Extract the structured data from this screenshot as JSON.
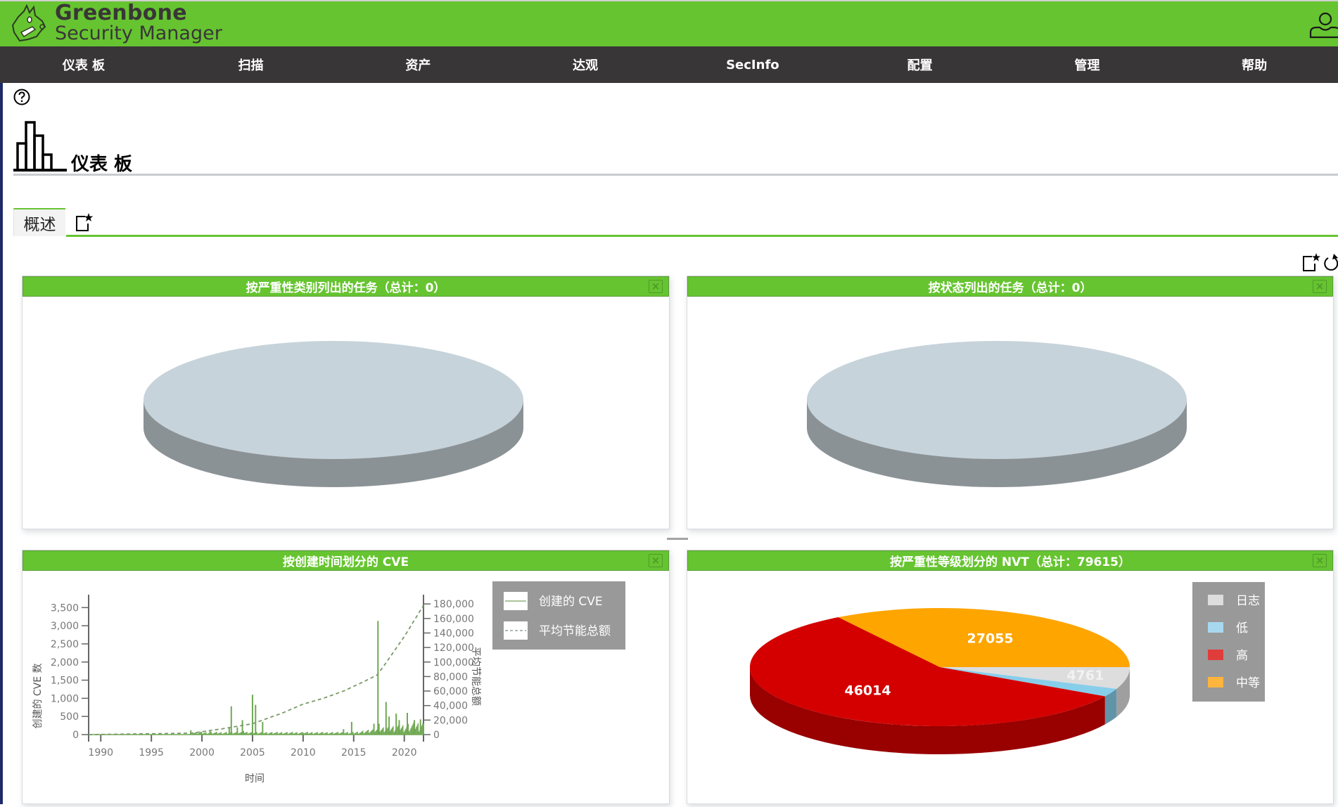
{
  "app": {
    "brand_name": "Greenbone",
    "brand_sub": "Security Manager"
  },
  "nav": {
    "items": [
      {
        "label": "仪表 板"
      },
      {
        "label": "扫描"
      },
      {
        "label": "资产"
      },
      {
        "label": "达观"
      },
      {
        "label": "SecInfo"
      },
      {
        "label": "配置"
      },
      {
        "label": "管理"
      },
      {
        "label": "帮助"
      }
    ]
  },
  "page": {
    "title": "仪表 板",
    "tabs": [
      {
        "label": "概述"
      }
    ]
  },
  "colors": {
    "brand_green": "#66c430",
    "nav_dark": "#393637",
    "severity_high": "#d40000",
    "severity_medium": "#fea500",
    "severity_low": "#87ceeb",
    "severity_log": "#dddddd"
  },
  "panels": [
    {
      "title": "按严重性类别列出的任务（总计：0）",
      "close_label": "×"
    },
    {
      "title": "按状态列出的任务（总计：0）",
      "close_label": "×"
    },
    {
      "title": "按创建时间划分的 CVE",
      "close_label": "×"
    },
    {
      "title": "按严重性等级划分的 NVT（总计：79615）",
      "close_label": "×"
    }
  ],
  "chart_data": [
    {
      "type": "pie",
      "title": "按严重性类别列出的任务（总计：0）",
      "labels": [],
      "values": [],
      "empty": true,
      "style": "3d"
    },
    {
      "type": "pie",
      "title": "按状态列出的任务（总计：0）",
      "labels": [],
      "values": [],
      "empty": true,
      "style": "3d"
    },
    {
      "type": "line",
      "title": "按创建时间划分的 CVE",
      "xlabel": "时间",
      "ylabel": "创建的 CVE 数",
      "y2label": "平均节能总额",
      "xlim": [
        1988.8,
        2021.9
      ],
      "ylim": [
        0,
        3700
      ],
      "y2lim": [
        0,
        185000
      ],
      "x_ticks": [
        "1990",
        "1995",
        "2000",
        "2005",
        "2010",
        "2015",
        "2020"
      ],
      "y_ticks": [
        "0",
        "500",
        "1,000",
        "1,500",
        "2,000",
        "2,500",
        "3,000",
        "3,500"
      ],
      "y2_ticks": [
        "0",
        "20,000",
        "40,000",
        "60,000",
        "80,000",
        "100,000",
        "120,000",
        "140,000",
        "160,000",
        "180,000"
      ],
      "legend": {
        "position": "top-right",
        "entries": [
          "创建的 CVE",
          "平均节能总额"
        ]
      },
      "series": [
        {
          "name": "创建的 CVE",
          "style": "solid",
          "color": "#70a853",
          "axis": "left",
          "x": [
            1988.8,
            1997.0,
            1998.9,
            1999.9,
            2000.8,
            2002.7,
            2002.9,
            2003.5,
            2004.0,
            2004.1,
            2005.0,
            2005.3,
            2006.0,
            2010.0,
            2014.0,
            2014.8,
            2017.0,
            2017.4,
            2017.5,
            2018.2,
            2018.5,
            2019.2,
            2019.5,
            2020.3,
            2021.0,
            2021.6,
            2021.9
          ],
          "y": [
            5,
            20,
            120,
            80,
            100,
            200,
            780,
            200,
            400,
            100,
            1100,
            820,
            350,
            50,
            150,
            350,
            300,
            3130,
            300,
            900,
            500,
            580,
            400,
            600,
            400,
            420,
            300
          ]
        },
        {
          "name": "平均节能总额",
          "style": "dashed",
          "color": "#7a9a68",
          "axis": "right",
          "x": [
            1988.8,
            1999.0,
            2002.0,
            2005.0,
            2008.0,
            2010.0,
            2012.0,
            2014.0,
            2016.0,
            2017.3,
            2018.0,
            2019.0,
            2020.0,
            2021.9
          ],
          "y": [
            0,
            2000,
            8000,
            15000,
            30000,
            42000,
            50000,
            60000,
            73000,
            82000,
            95000,
            115000,
            135000,
            178000
          ]
        }
      ]
    },
    {
      "type": "pie",
      "title": "按严重性等级划分的 NVT（总计：79615）",
      "style": "3d",
      "total": 79615,
      "labels": [
        "日志",
        "低",
        "高",
        "中等"
      ],
      "values": [
        4761,
        1785,
        46014,
        27055
      ],
      "data_labels": [
        "4761",
        "",
        "46014",
        "27055"
      ],
      "colors": [
        "#dddddd",
        "#87ceeb",
        "#d40000",
        "#fea500"
      ],
      "legend": {
        "position": "right",
        "entries": [
          "日志",
          "低",
          "高",
          "中等"
        ],
        "swatch_colors": [
          "#dddddd",
          "#a8d8f0",
          "#e03c3c",
          "#fdb53d"
        ]
      }
    }
  ]
}
